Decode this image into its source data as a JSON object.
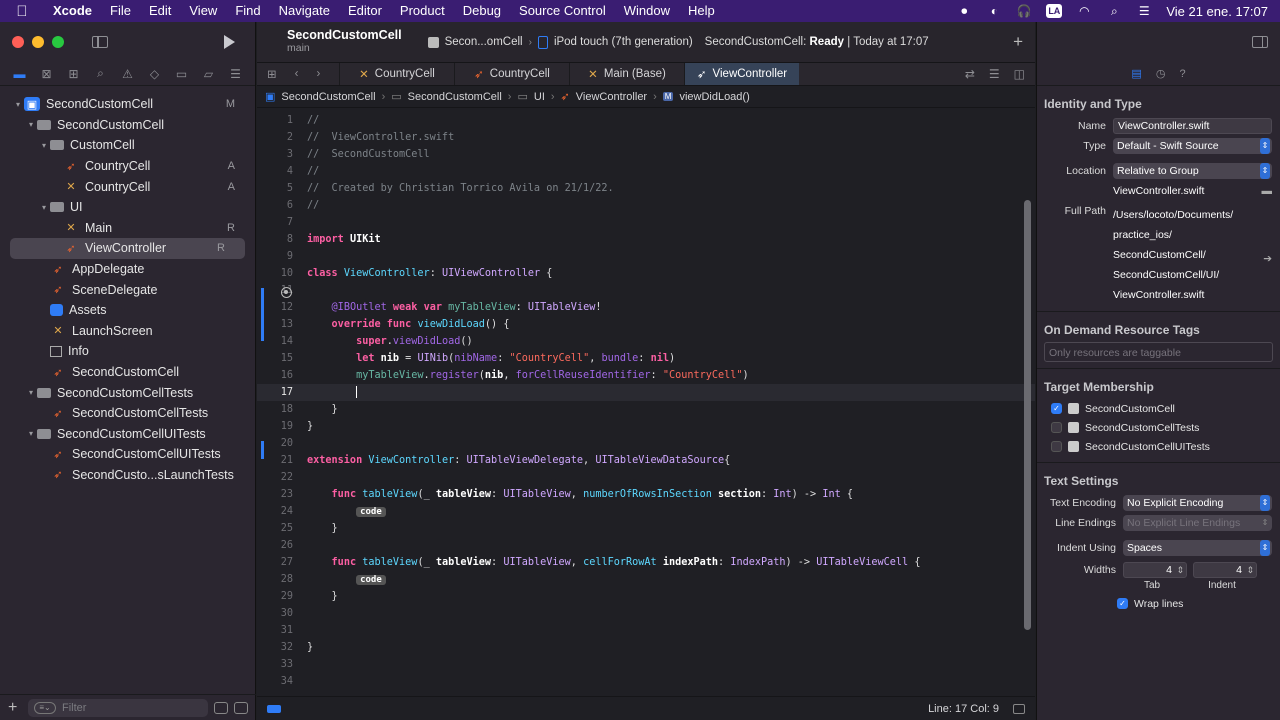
{
  "menubar": {
    "app": "Xcode",
    "items": [
      "File",
      "Edit",
      "View",
      "Find",
      "Navigate",
      "Editor",
      "Product",
      "Debug",
      "Source Control",
      "Window",
      "Help"
    ],
    "input_source": "LA",
    "datetime": "Vie 21 ene.  17:07"
  },
  "navigator": {
    "tree": [
      {
        "label": "SecondCustomCell",
        "icon": "project-icon",
        "indent": 0,
        "disclose": "▾",
        "badge": "M"
      },
      {
        "label": "SecondCustomCell",
        "icon": "folder-icon",
        "indent": 1,
        "disclose": "▾",
        "badge": ""
      },
      {
        "label": "CustomCell",
        "icon": "folder-icon",
        "indent": 2,
        "disclose": "▾",
        "badge": ""
      },
      {
        "label": "CountryCell",
        "icon": "swift-file-icon",
        "indent": 3,
        "disclose": "",
        "badge": "A"
      },
      {
        "label": "CountryCell",
        "icon": "xib-file-icon",
        "indent": 3,
        "disclose": "",
        "badge": "A"
      },
      {
        "label": "UI",
        "icon": "folder-icon",
        "indent": 2,
        "disclose": "▾",
        "badge": ""
      },
      {
        "label": "Main",
        "icon": "xib-file-icon",
        "indent": 3,
        "disclose": "",
        "badge": "R"
      },
      {
        "label": "ViewController",
        "icon": "swift-file-icon",
        "indent": 3,
        "disclose": "",
        "badge": "R",
        "selected": true
      },
      {
        "label": "AppDelegate",
        "icon": "swift-file-icon",
        "indent": 2,
        "disclose": "",
        "badge": ""
      },
      {
        "label": "SceneDelegate",
        "icon": "swift-file-icon",
        "indent": 2,
        "disclose": "",
        "badge": ""
      },
      {
        "label": "Assets",
        "icon": "assets-icon",
        "indent": 2,
        "disclose": "",
        "badge": ""
      },
      {
        "label": "LaunchScreen",
        "icon": "xib-file-icon",
        "indent": 2,
        "disclose": "",
        "badge": ""
      },
      {
        "label": "Info",
        "icon": "plist-icon",
        "indent": 2,
        "disclose": "",
        "badge": ""
      },
      {
        "label": "SecondCustomCell",
        "icon": "swift-file-icon",
        "indent": 2,
        "disclose": "",
        "badge": ""
      },
      {
        "label": "SecondCustomCellTests",
        "icon": "folder-icon",
        "indent": 1,
        "disclose": "▾",
        "badge": ""
      },
      {
        "label": "SecondCustomCellTests",
        "icon": "swift-file-icon",
        "indent": 2,
        "disclose": "",
        "badge": ""
      },
      {
        "label": "SecondCustomCellUITests",
        "icon": "folder-icon",
        "indent": 1,
        "disclose": "▾",
        "badge": ""
      },
      {
        "label": "SecondCustomCellUITests",
        "icon": "swift-file-icon",
        "indent": 2,
        "disclose": "",
        "badge": ""
      },
      {
        "label": "SecondCusto...sLaunchTests",
        "icon": "swift-file-icon",
        "indent": 2,
        "disclose": "",
        "badge": ""
      }
    ],
    "filter_placeholder": "Filter"
  },
  "toolbar": {
    "project_name": "SecondCustomCell",
    "branch": "main",
    "scheme": "Secon...omCell",
    "device": "iPod touch (7th generation)",
    "status_prefix": "SecondCustomCell: ",
    "status_state": "Ready",
    "status_suffix": " | Today at 17:07"
  },
  "tabs": [
    {
      "label": "CountryCell",
      "icon": "xib-file-icon",
      "active": false
    },
    {
      "label": "CountryCell",
      "icon": "swift-file-icon",
      "active": false
    },
    {
      "label": "Main (Base)",
      "icon": "xib-file-icon",
      "active": false
    },
    {
      "label": "ViewController",
      "icon": "swift-file-icon",
      "active": true
    }
  ],
  "jumpbar": [
    "SecondCustomCell",
    "SecondCustomCell",
    "UI",
    "ViewController",
    "viewDidLoad()"
  ],
  "code": {
    "current_line": 17,
    "lines": [
      [
        [
          "cm",
          "//"
        ]
      ],
      [
        [
          "cm",
          "//  ViewController.swift"
        ]
      ],
      [
        [
          "cm",
          "//  SecondCustomCell"
        ]
      ],
      [
        [
          "cm",
          "//"
        ]
      ],
      [
        [
          "cm",
          "//  Created by Christian Torrico Avila on 21/1/22."
        ]
      ],
      [
        [
          "cm",
          "//"
        ]
      ],
      [],
      [
        [
          "kw",
          "import"
        ],
        [
          "txt",
          " "
        ],
        [
          "bold",
          "UIKit"
        ]
      ],
      [],
      [
        [
          "kw",
          "class"
        ],
        [
          "txt",
          " "
        ],
        [
          "nm",
          "ViewController"
        ],
        [
          "txt",
          ": "
        ],
        [
          "ty",
          "UIViewController"
        ],
        [
          "txt",
          " {"
        ]
      ],
      [],
      [
        [
          "txt",
          "    "
        ],
        [
          "pr",
          "@IBOutlet"
        ],
        [
          "txt",
          " "
        ],
        [
          "kw",
          "weak"
        ],
        [
          "txt",
          " "
        ],
        [
          "kw",
          "var"
        ],
        [
          "txt",
          " "
        ],
        [
          "fn",
          "myTableView"
        ],
        [
          "txt",
          ": "
        ],
        [
          "ty",
          "UITableView"
        ],
        [
          "txt",
          "!"
        ]
      ],
      [
        [
          "txt",
          "    "
        ],
        [
          "kw",
          "override"
        ],
        [
          "txt",
          " "
        ],
        [
          "kw",
          "func"
        ],
        [
          "txt",
          " "
        ],
        [
          "nm",
          "viewDidLoad"
        ],
        [
          "txt",
          "() {"
        ]
      ],
      [
        [
          "txt",
          "        "
        ],
        [
          "kw",
          "super"
        ],
        [
          "txt",
          "."
        ],
        [
          "ty2",
          "viewDidLoad"
        ],
        [
          "txt",
          "()"
        ]
      ],
      [
        [
          "txt",
          "        "
        ],
        [
          "kw",
          "let"
        ],
        [
          "txt",
          " "
        ],
        [
          "bold",
          "nib"
        ],
        [
          "txt",
          " = "
        ],
        [
          "ty",
          "UINib"
        ],
        [
          "txt",
          "("
        ],
        [
          "ty2",
          "nibName"
        ],
        [
          "txt",
          ": "
        ],
        [
          "st",
          "\"CountryCell\""
        ],
        [
          "txt",
          ", "
        ],
        [
          "ty2",
          "bundle"
        ],
        [
          "txt",
          ": "
        ],
        [
          "kw",
          "nil"
        ],
        [
          "txt",
          ")"
        ]
      ],
      [
        [
          "txt",
          "        "
        ],
        [
          "fn",
          "myTableView"
        ],
        [
          "txt",
          "."
        ],
        [
          "ty2",
          "register"
        ],
        [
          "txt",
          "("
        ],
        [
          "bold",
          "nib"
        ],
        [
          "txt",
          ", "
        ],
        [
          "ty2",
          "forCellReuseIdentifier"
        ],
        [
          "txt",
          ": "
        ],
        [
          "st",
          "\"CountryCell\""
        ],
        [
          "txt",
          ")"
        ]
      ],
      [
        [
          "txt",
          "        "
        ],
        [
          "cursor",
          ""
        ]
      ],
      [
        [
          "txt",
          "    }"
        ]
      ],
      [
        [
          "txt",
          "}"
        ]
      ],
      [],
      [
        [
          "kw",
          "extension"
        ],
        [
          "txt",
          " "
        ],
        [
          "nm",
          "ViewController"
        ],
        [
          "txt",
          ": "
        ],
        [
          "ty",
          "UITableViewDelegate"
        ],
        [
          "txt",
          ", "
        ],
        [
          "ty",
          "UITableViewDataSource"
        ],
        [
          "txt",
          "{"
        ]
      ],
      [],
      [
        [
          "txt",
          "    "
        ],
        [
          "kw",
          "func"
        ],
        [
          "txt",
          " "
        ],
        [
          "nm",
          "tableView"
        ],
        [
          "txt",
          "(_ "
        ],
        [
          "bold",
          "tableView"
        ],
        [
          "txt",
          ": "
        ],
        [
          "ty",
          "UITableView"
        ],
        [
          "txt",
          ", "
        ],
        [
          "nm",
          "numberOfRowsInSection"
        ],
        [
          "txt",
          " "
        ],
        [
          "bold",
          "section"
        ],
        [
          "txt",
          ": "
        ],
        [
          "ty",
          "Int"
        ],
        [
          "txt",
          ") -> "
        ],
        [
          "ty",
          "Int"
        ],
        [
          "txt",
          " {"
        ]
      ],
      [
        [
          "txt",
          "        "
        ],
        [
          "tok",
          "code"
        ]
      ],
      [
        [
          "txt",
          "    }"
        ]
      ],
      [],
      [
        [
          "txt",
          "    "
        ],
        [
          "kw",
          "func"
        ],
        [
          "txt",
          " "
        ],
        [
          "nm",
          "tableView"
        ],
        [
          "txt",
          "(_ "
        ],
        [
          "bold",
          "tableView"
        ],
        [
          "txt",
          ": "
        ],
        [
          "ty",
          "UITableView"
        ],
        [
          "txt",
          ", "
        ],
        [
          "nm",
          "cellForRowAt"
        ],
        [
          "txt",
          " "
        ],
        [
          "bold",
          "indexPath"
        ],
        [
          "txt",
          ": "
        ],
        [
          "ty",
          "IndexPath"
        ],
        [
          "txt",
          ") -> "
        ],
        [
          "ty",
          "UITableViewCell"
        ],
        [
          "txt",
          " {"
        ]
      ],
      [
        [
          "txt",
          "        "
        ],
        [
          "tok",
          "code"
        ]
      ],
      [
        [
          "txt",
          "    }"
        ]
      ],
      [],
      [],
      [
        [
          "txt",
          "}"
        ]
      ],
      [],
      []
    ]
  },
  "statusbar": {
    "position": "Line: 17  Col: 9"
  },
  "inspector": {
    "identity_title": "Identity and Type",
    "name_label": "Name",
    "name_value": "ViewController.swift",
    "type_label": "Type",
    "type_value": "Default - Swift Source",
    "location_label": "Location",
    "location_value": "Relative to Group",
    "location_file": "ViewController.swift",
    "fullpath_label": "Full Path",
    "fullpath_lines": [
      "/Users/locoto/Documents/",
      "practice_ios/",
      "SecondCustomCell/",
      "SecondCustomCell/UI/",
      "ViewController.swift"
    ],
    "odr_title": "On Demand Resource Tags",
    "odr_placeholder": "Only resources are taggable",
    "target_title": "Target Membership",
    "targets": [
      {
        "label": "SecondCustomCell",
        "checked": true
      },
      {
        "label": "SecondCustomCellTests",
        "checked": false
      },
      {
        "label": "SecondCustomCellUITests",
        "checked": false
      }
    ],
    "text_title": "Text Settings",
    "encoding_label": "Text Encoding",
    "encoding_value": "No Explicit Encoding",
    "endings_label": "Line Endings",
    "endings_value": "No Explicit Line Endings",
    "indent_label": "Indent Using",
    "indent_value": "Spaces",
    "widths_label": "Widths",
    "tab_width": "4",
    "indent_width": "4",
    "tab_label": "Tab",
    "indent_sub_label": "Indent",
    "wrap_label": "Wrap lines",
    "wrap_checked": true
  }
}
